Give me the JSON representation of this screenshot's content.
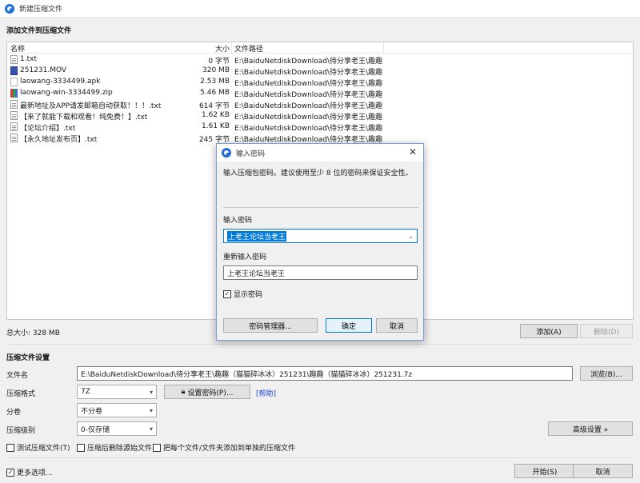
{
  "window": {
    "title": "新建压缩文件"
  },
  "add_section": {
    "title": "添加文件到压缩文件"
  },
  "file_list": {
    "columns": {
      "name": "名称",
      "size": "大小",
      "path": "文件路径"
    },
    "rows": [
      {
        "icon": "text-file-icon",
        "name": "1.txt",
        "size": "0 字节",
        "path": "E:\\BaiduNetdiskDownload\\待分享老王\\趣趣"
      },
      {
        "icon": "video-file-icon",
        "name": "251231.MOV",
        "size": "320 MB",
        "path": "E:\\BaiduNetdiskDownload\\待分享老王\\趣趣"
      },
      {
        "icon": "apk-file-icon",
        "name": "laowang-3334499.apk",
        "size": "2.53 MB",
        "path": "E:\\BaiduNetdiskDownload\\待分享老王\\趣趣"
      },
      {
        "icon": "zip-file-icon",
        "name": "laowang-win-3334499.zip",
        "size": "5.46 MB",
        "path": "E:\\BaiduNetdiskDownload\\待分享老王\\趣趣"
      },
      {
        "icon": "text-file-icon",
        "name": "最新地址及APP请发邮箱自动获取！！！.txt",
        "size": "614 字节",
        "path": "E:\\BaiduNetdiskDownload\\待分享老王\\趣趣"
      },
      {
        "icon": "text-file-icon",
        "name": "【来了就能下载和观看！纯免费！】.txt",
        "size": "1.62 KB",
        "path": "E:\\BaiduNetdiskDownload\\待分享老王\\趣趣"
      },
      {
        "icon": "text-file-icon",
        "name": "【论坛介绍】.txt",
        "size": "1.61 KB",
        "path": "E:\\BaiduNetdiskDownload\\待分享老王\\趣趣"
      },
      {
        "icon": "text-file-icon",
        "name": "【永久地址发布页】.txt",
        "size": "245 字节",
        "path": "E:\\BaiduNetdiskDownload\\待分享老王\\趣趣"
      }
    ]
  },
  "total_size": "总大小: 328 MB",
  "buttons": {
    "add": "添加(A)",
    "remove": "删除(D)",
    "browse": "浏览(B)...",
    "set_password": "设置密码(P)...",
    "advanced": "高级设置 »",
    "start": "开始(S)",
    "cancel": "取消"
  },
  "settings": {
    "title": "压缩文件设置",
    "filename_label": "文件名",
    "filename_value": "E:\\BaiduNetdiskDownload\\待分享老王\\趣趣（猫猫碎冰冰）251231\\趣趣（猫猫碎冰冰）251231.7z",
    "format_label": "压缩格式",
    "format_value": "7Z",
    "help_link": "[帮助]",
    "split_label": "分卷",
    "split_value": "不分卷",
    "level_label": "压缩级别",
    "level_value": "0-仅存储"
  },
  "options": {
    "test": "测试压缩文件(T)",
    "delete_source": "压缩后删除源始文件",
    "each_separately": "把每个文件/文件夹添加到单独的压缩文件",
    "more_options": "更多选项..."
  },
  "dialog": {
    "title": "输入密码",
    "message": "输入压缩包密码。建议使用至少 8 位的密码来保证安全性。",
    "password_label": "输入密码",
    "password_value": "上老王论坛当老王",
    "reenter_label": "重新输入密码",
    "reenter_value": "上老王论坛当老王",
    "show_password": "显示密码",
    "manager_button": "密码管理器...",
    "ok_button": "确定",
    "cancel_button": "取消"
  },
  "colors": {
    "accent": "#0078d7",
    "link": "#1a44d6",
    "selection": "#0078d7"
  }
}
